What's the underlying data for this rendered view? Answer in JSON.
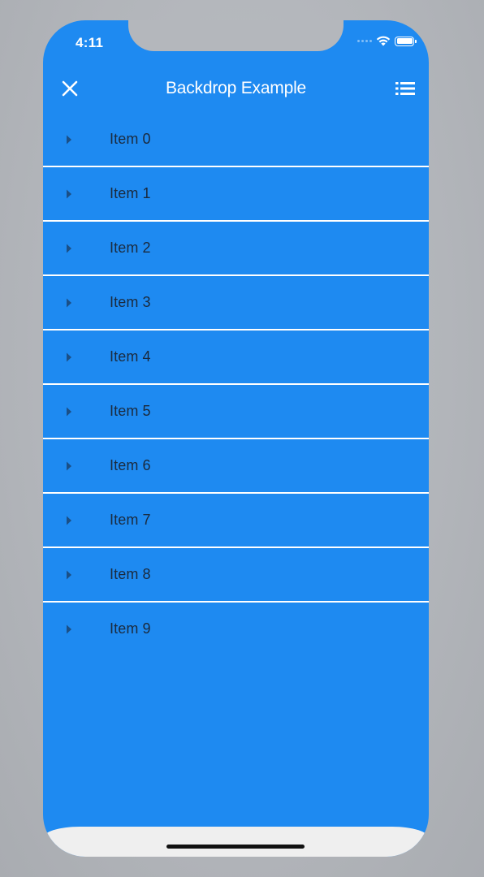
{
  "status_bar": {
    "time": "4:11"
  },
  "app_bar": {
    "title": "Backdrop Example",
    "close_icon": "close-icon",
    "menu_icon": "list-icon"
  },
  "list": {
    "items": [
      {
        "label": "Item 0"
      },
      {
        "label": "Item 1"
      },
      {
        "label": "Item 2"
      },
      {
        "label": "Item 3"
      },
      {
        "label": "Item 4"
      },
      {
        "label": "Item 5"
      },
      {
        "label": "Item 6"
      },
      {
        "label": "Item 7"
      },
      {
        "label": "Item 8"
      },
      {
        "label": "Item 9"
      }
    ],
    "arrow_icon": "arrow-right-icon"
  },
  "colors": {
    "app_background": "#1e8af1",
    "divider": "#ffffff",
    "item_text": "#1b2a3d",
    "arrow": "#1b4f86",
    "home_area": "#efefef"
  }
}
